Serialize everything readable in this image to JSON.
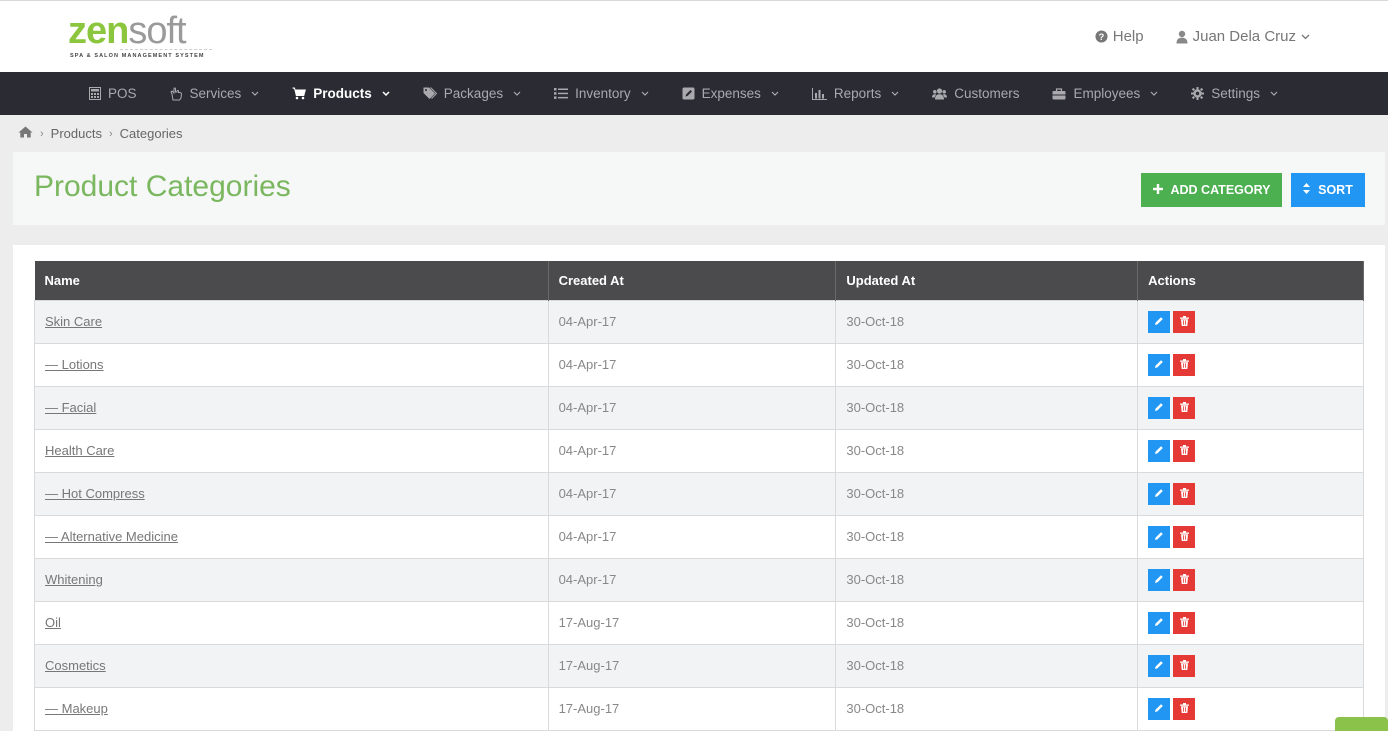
{
  "brand": {
    "logo_zen": "zen",
    "logo_soft": "soft",
    "tagline": "SPA & SALON MANAGEMENT SYSTEM"
  },
  "topbar": {
    "help_label": "Help",
    "user_name": "Juan Dela Cruz"
  },
  "nav": {
    "items": [
      {
        "label": "POS",
        "icon": "calculator-icon",
        "caret": false
      },
      {
        "label": "Services",
        "icon": "hand-icon",
        "caret": true
      },
      {
        "label": "Products",
        "icon": "cart-icon",
        "caret": true,
        "active": true
      },
      {
        "label": "Packages",
        "icon": "tags-icon",
        "caret": true
      },
      {
        "label": "Inventory",
        "icon": "list-icon",
        "caret": true
      },
      {
        "label": "Expenses",
        "icon": "edit-square-icon",
        "caret": true
      },
      {
        "label": "Reports",
        "icon": "bar-chart-icon",
        "caret": true
      },
      {
        "label": "Customers",
        "icon": "users-icon",
        "caret": false
      },
      {
        "label": "Employees",
        "icon": "briefcase-icon",
        "caret": true
      },
      {
        "label": "Settings",
        "icon": "gear-icon",
        "caret": true
      }
    ]
  },
  "breadcrumb": {
    "items": [
      "Products",
      "Categories"
    ]
  },
  "page": {
    "title": "Product Categories",
    "add_button": "ADD CATEGORY",
    "sort_button": "SORT"
  },
  "table": {
    "columns": [
      "Name",
      "Created At",
      "Updated At",
      "Actions"
    ],
    "rows": [
      {
        "name": "Skin Care",
        "created": "04-Apr-17",
        "updated": "30-Oct-18"
      },
      {
        "name": "— Lotions",
        "created": "04-Apr-17",
        "updated": "30-Oct-18"
      },
      {
        "name": "— Facial",
        "created": "04-Apr-17",
        "updated": "30-Oct-18"
      },
      {
        "name": "Health Care",
        "created": "04-Apr-17",
        "updated": "30-Oct-18"
      },
      {
        "name": "— Hot Compress",
        "created": "04-Apr-17",
        "updated": "30-Oct-18"
      },
      {
        "name": "— Alternative Medicine",
        "created": "04-Apr-17",
        "updated": "30-Oct-18"
      },
      {
        "name": "Whitening",
        "created": "04-Apr-17",
        "updated": "30-Oct-18"
      },
      {
        "name": "Oil",
        "created": "17-Aug-17",
        "updated": "30-Oct-18"
      },
      {
        "name": "Cosmetics",
        "created": "17-Aug-17",
        "updated": "30-Oct-18"
      },
      {
        "name": "— Makeup",
        "created": "17-Aug-17",
        "updated": "30-Oct-18"
      }
    ]
  },
  "colors": {
    "brand_green": "#8cc63f",
    "title_green": "#7ab75f",
    "nav_bg": "#2a2b33",
    "add_button": "#4caf50",
    "sort_button": "#2196f3",
    "edit_button": "#2196f3",
    "delete_button": "#e53935",
    "table_header": "#4b4b4d"
  }
}
